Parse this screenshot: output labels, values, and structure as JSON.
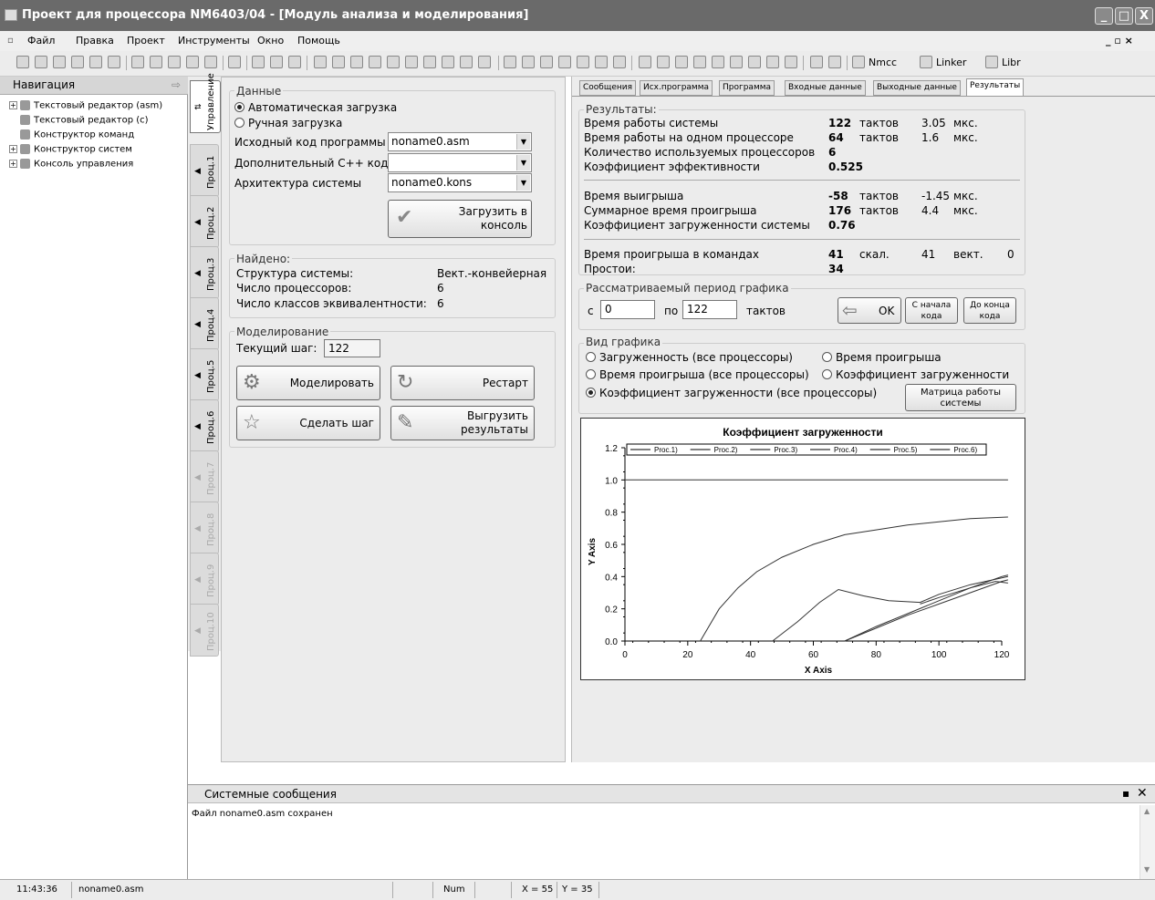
{
  "window": {
    "title": "Проект для процессора NM6403/04 - [Модуль анализа и моделирования]",
    "controls": [
      "_",
      "□",
      "X"
    ]
  },
  "menu": {
    "items": [
      "Файл",
      "Правка",
      "Проект",
      "Инструменты",
      "Окно",
      "Помощь"
    ],
    "right_controls": "_ ▫ ×"
  },
  "toolbar": {
    "nmcc_label": "Nmcc",
    "linker_label": "Linker",
    "libr_label": "Libr"
  },
  "navigation": {
    "title": "Навигация",
    "items": [
      {
        "label": "Текстовый редактор (asm)",
        "expander": "+"
      },
      {
        "label": "Текстовый редактор (c)",
        "expander": ""
      },
      {
        "label": "Конструктор команд",
        "expander": ""
      },
      {
        "label": "Конструктор систем",
        "expander": "+"
      },
      {
        "label": "Консоль управления",
        "expander": "+"
      }
    ]
  },
  "vertical_tabs": [
    "Управление",
    "Проц.1",
    "Проц.2",
    "Проц.3",
    "Проц.4",
    "Проц.5",
    "Проц.6",
    "Проц.7",
    "Проц.8",
    "Проц.9",
    "Проц.10"
  ],
  "data_group": {
    "title": "Данные",
    "auto_load": "Автоматическая загрузка",
    "manual_load": "Ручная загрузка",
    "source_label": "Исходный код программы",
    "source_value": "noname0.asm",
    "cpp_label": "Дополнительный C++ код",
    "cpp_value": "",
    "arch_label": "Архитектура системы",
    "arch_value": "noname0.kons",
    "load_button": "Загрузить в консоль"
  },
  "found_group": {
    "title": "Найдено:",
    "structure_label": "Структура системы:",
    "structure_value": "Вект.-конвейерная",
    "processors_label": "Число процессоров:",
    "processors_value": "6",
    "classes_label": "Число классов эквивалентности:",
    "classes_value": "6"
  },
  "modeling_group": {
    "title": "Моделирование",
    "step_label": "Текущий шаг:",
    "step_value": "122",
    "simulate_button": "Моделировать",
    "restart_button": "Рестарт",
    "step_button": "Сделать шаг",
    "export_button": "Выгрузить результаты"
  },
  "right_tabs": [
    "Сообщения",
    "Исх.программа",
    "Программа",
    "Входные данные",
    "Выходные данные",
    "Результаты"
  ],
  "results": {
    "title": "Результаты:",
    "system_time_label": "Время работы системы",
    "system_time_value": "122",
    "system_time_unit": "тактов",
    "system_time_us": "3.05",
    "system_time_us_unit": "мкс.",
    "single_time_label": "Время работы на одном процессоре",
    "single_time_value": "64",
    "single_time_unit": "тактов",
    "single_time_us": "1.6",
    "single_time_us_unit": "мкс.",
    "proc_count_label": "Количество используемых процессоров",
    "proc_count_value": "6",
    "efficiency_label": "Коэффициент эффективности",
    "efficiency_value": "0.525",
    "gain_label": "Время выигрыша",
    "gain_value": "-58",
    "gain_unit": "тактов",
    "gain_us": "-1.45",
    "gain_us_unit": "мкс.",
    "loss_label": "Суммарное время проигрыша",
    "loss_value": "176",
    "loss_unit": "тактов",
    "loss_us": "4.4",
    "loss_us_unit": "мкс.",
    "load_coef_label": "Коэффициент загруженности системы",
    "load_coef_value": "0.76",
    "cmd_loss_label": "Время проигрыша в командах",
    "cmd_loss_value": "41",
    "scalar_label": "скал.",
    "scalar_value": "41",
    "vector_label": "вект.",
    "vector_value": "0",
    "idle_label": "Простои:",
    "idle_value": "34"
  },
  "period": {
    "title": "Рассматриваемый период графика",
    "from_label": "с",
    "from_value": "0",
    "to_label": "по",
    "to_value": "122",
    "unit": "тактов",
    "ok_button": "OK",
    "start_button": "С начала кода",
    "end_button": "До конца кода"
  },
  "graph_type": {
    "title": "Вид графика",
    "opt1": "Загруженность (все процессоры)",
    "opt2": "Время проигрыша",
    "opt3": "Время проигрыша (все процессоры)",
    "opt4": "Коэффициент загруженности",
    "opt5": "Коэффициент загруженности (все процессоры)",
    "matrix_button": "Матрица работы системы"
  },
  "chart_data": {
    "type": "line",
    "title": "Коэффициент загруженности",
    "xlabel": "X Axis",
    "ylabel": "Y Axis",
    "xlim": [
      0,
      120
    ],
    "ylim": [
      0,
      1.2
    ],
    "xticks": [
      "0",
      "20",
      "40",
      "60",
      "80",
      "100",
      "120"
    ],
    "yticks": [
      "0.0",
      "0.2",
      "0.4",
      "0.6",
      "0.8",
      "1.0",
      "1.2"
    ],
    "legend_position": "top",
    "series": [
      {
        "name": "Proc.1)",
        "x": [
          0,
          122
        ],
        "y": [
          1.0,
          1.0
        ]
      },
      {
        "name": "Proc.2)",
        "x": [
          24,
          30,
          36,
          42,
          50,
          60,
          70,
          80,
          90,
          100,
          110,
          122
        ],
        "y": [
          0.0,
          0.2,
          0.33,
          0.43,
          0.52,
          0.6,
          0.66,
          0.69,
          0.72,
          0.74,
          0.76,
          0.77
        ]
      },
      {
        "name": "Proc.3)",
        "x": [
          47,
          55,
          62,
          68,
          76,
          84,
          94,
          100,
          110,
          122
        ],
        "y": [
          0.0,
          0.12,
          0.24,
          0.32,
          0.28,
          0.25,
          0.24,
          0.29,
          0.35,
          0.4
        ]
      },
      {
        "name": "Proc.4)",
        "x": [
          70,
          80,
          90,
          100,
          110,
          120,
          122
        ],
        "y": [
          0.0,
          0.09,
          0.17,
          0.25,
          0.33,
          0.4,
          0.41
        ]
      },
      {
        "name": "Proc.5)",
        "x": [
          70,
          80,
          90,
          100,
          110,
          120,
          122
        ],
        "y": [
          0.0,
          0.08,
          0.16,
          0.23,
          0.3,
          0.37,
          0.38
        ]
      },
      {
        "name": "Proc.6)",
        "x": [
          94,
          100,
          110,
          118,
          122
        ],
        "y": [
          0.23,
          0.27,
          0.33,
          0.37,
          0.36
        ]
      }
    ],
    "colors": {
      "line": "#333333",
      "axis": "#000000"
    }
  },
  "system_messages": {
    "title": "Системные сообщения",
    "lines": [
      "Файл noname0.asm сохранен"
    ]
  },
  "statusbar": {
    "time": "11:43:36",
    "file": "noname0.asm",
    "num": "Num",
    "x": "X = 55",
    "y": "Y = 35"
  }
}
